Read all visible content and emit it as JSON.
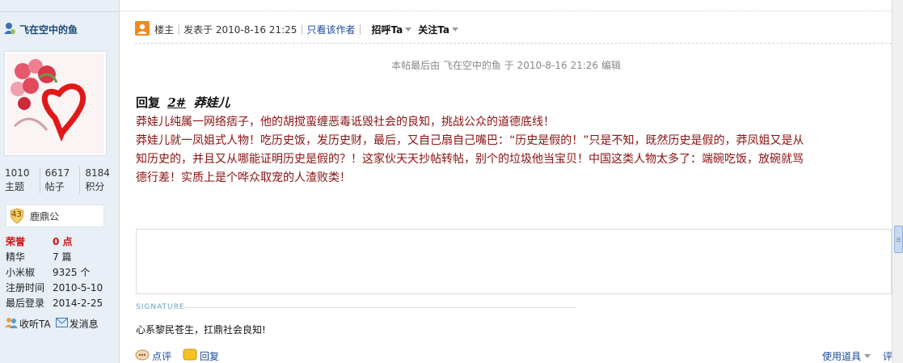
{
  "sidebar": {
    "username": "飞在空中的鱼",
    "stats": [
      {
        "value": "1010",
        "label": "主题"
      },
      {
        "value": "6617",
        "label": "帖子"
      },
      {
        "value": "8184",
        "label": "积分"
      }
    ],
    "rank": {
      "level": "43",
      "name": "鹿鼎公"
    },
    "info": [
      {
        "key": "荣誉",
        "value": "0 点"
      },
      {
        "key": "精华",
        "value": "7 篇"
      },
      {
        "key": "小米椒",
        "value": "9325 个"
      },
      {
        "key": "注册时间",
        "value": "2010-5-10"
      },
      {
        "key": "最后登录",
        "value": "2014-2-25"
      }
    ],
    "actions": {
      "follow": "收听TA",
      "message": "发消息"
    }
  },
  "post": {
    "floor": "楼主",
    "posted_at": "发表于 2010-8-16 21:25",
    "only_author": "只看该作者",
    "greet": "招呼Ta",
    "follow": "关注Ta",
    "edit_note": "本帖最后由 飞在空中的鱼 于 2010-8-16 21:26 编辑",
    "reply_prefix": "回复",
    "reply_floor": "2#",
    "reply_name": "莽娃儿",
    "content_lines": [
      "莽娃儿纯属一网络痞子，他的胡搅蛮缠恶毒诋毁社会的良知，挑战公众的道德底线！",
      "莽娃儿就一凤姐式人物！吃历史饭，发历史财，最后，又自己扇自己嘴巴：“历史是假的！”只是不知，既然历史是假的，莽凤姐又是从",
      "知历史的，并且又从哪能证明历史是假的？！这家伙天天抄帖转帖，别个的垃圾他当宝贝！中国这类人物太多了：端碗吃饭，放碗就骂",
      "德行差！实质上是个哗众取宠的人渣败类！"
    ],
    "signature_label": "SIGNATURE",
    "signature": "心系黎民苍生，扛鼎社会良知!"
  },
  "footer": {
    "comment": "点评",
    "reply": "回复",
    "tools": "使用道具",
    "report": "评"
  },
  "colors": {
    "content": "#8b1010",
    "link": "#1a4a9a",
    "honor": "#d01010",
    "sidebar_bg": "#e8eff6"
  }
}
